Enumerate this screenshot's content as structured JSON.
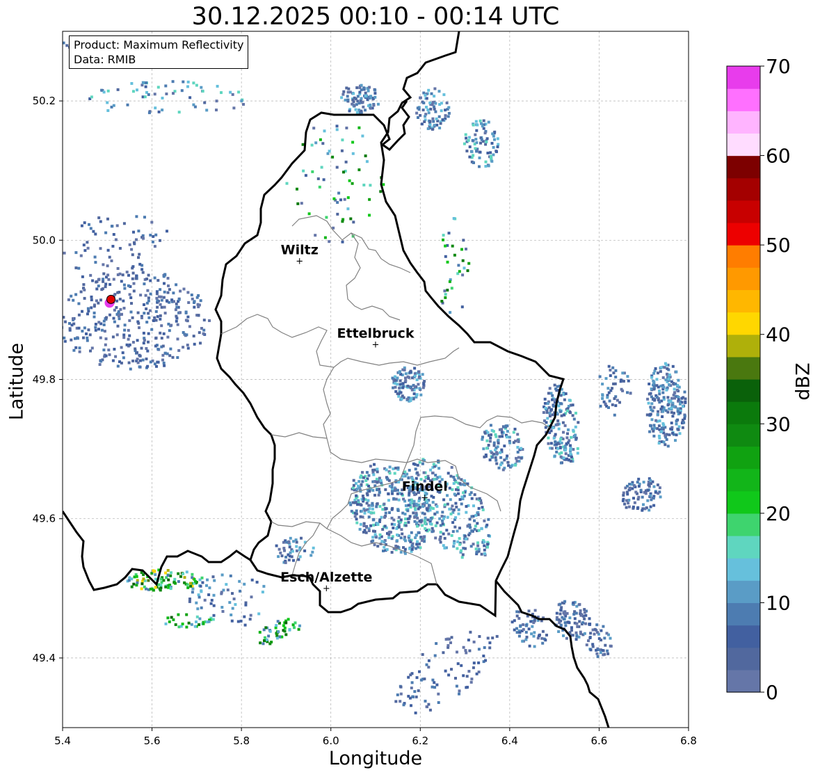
{
  "title": "30.12.2025 00:10 - 00:14 UTC",
  "info": {
    "product": "Product: Maximum Reflectivity",
    "source": "Data: RMIB"
  },
  "axes": {
    "xlabel": "Longitude",
    "ylabel": "Latitude",
    "xlim": [
      5.4,
      6.8
    ],
    "ylim": [
      49.3,
      50.3
    ],
    "xticks": [
      "5.4",
      "5.6",
      "5.8",
      "6.0",
      "6.2",
      "6.4",
      "6.6",
      "6.8"
    ],
    "yticks": [
      "49.4",
      "49.6",
      "49.8",
      "50.0",
      "50.2"
    ],
    "grid": true
  },
  "colorbar": {
    "label": "dBZ",
    "min": 0,
    "max": 70,
    "ticks": [
      "0",
      "10",
      "20",
      "30",
      "40",
      "50",
      "60",
      "70"
    ],
    "colors": [
      "#6576a8",
      "#51689e",
      "#4260a0",
      "#4d7cb1",
      "#5a9cc6",
      "#66c0dc",
      "#5fd6bf",
      "#3ed46e",
      "#10c81a",
      "#12b519",
      "#10a211",
      "#0f8a11",
      "#0b7a0c",
      "#0a610a",
      "#4a780f",
      "#afb00a",
      "#ffd700",
      "#ffb700",
      "#ff9900",
      "#ff7d00",
      "#ed0000",
      "#c80000",
      "#a40000",
      "#7d0000",
      "#ffdcff",
      "#ffb4ff",
      "#ff70ff",
      "#e83cec"
    ]
  },
  "places": [
    {
      "name": "Wiltz",
      "lon": 5.93,
      "lat": 49.97
    },
    {
      "name": "Ettelbruck",
      "lon": 6.1,
      "lat": 49.85
    },
    {
      "name": "Findel",
      "lon": 6.21,
      "lat": 49.63
    },
    {
      "name": "Esch/Alzette",
      "lon": 5.99,
      "lat": 49.5
    }
  ],
  "radar_site": {
    "lon": 5.505,
    "lat": 49.915,
    "color": "#e00000"
  },
  "colors": {
    "border": "#000000",
    "canton": "#808080",
    "grid": "#b0b0b0"
  }
}
